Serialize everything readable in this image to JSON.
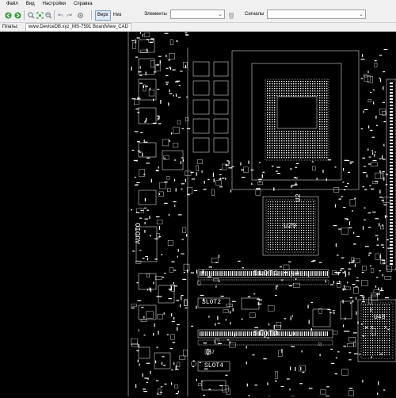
{
  "menu": {
    "items": [
      {
        "label": "Файл"
      },
      {
        "label": "Вид"
      },
      {
        "label": "Настройки"
      },
      {
        "label": "Справка"
      }
    ]
  },
  "toolbar": {
    "view_top_label": "Верх",
    "view_bottom_label": "Низ",
    "elements_label": "Элементы",
    "signals_label": "Сигналы",
    "elements_value": "",
    "signals_value": ""
  },
  "tabs": {
    "label": "Платы:",
    "active_tab": "www.DeviceDB.xyz_MS-7591 BoardView_CAD"
  },
  "board": {
    "labels": {
      "audio": "AUDIO",
      "u2": "U2",
      "u29": "U29",
      "slot1": "SLOT1",
      "slot2": "SLOT2",
      "slot3": "SLOT3",
      "slot4": "SLOT4",
      "u48": "U48",
      "q57": "Q57"
    }
  },
  "colors": {
    "ui_background": "#f0f0f0",
    "board_background": "#000000",
    "trace": "#ffffff",
    "arrow_green": "#2e9a38"
  }
}
